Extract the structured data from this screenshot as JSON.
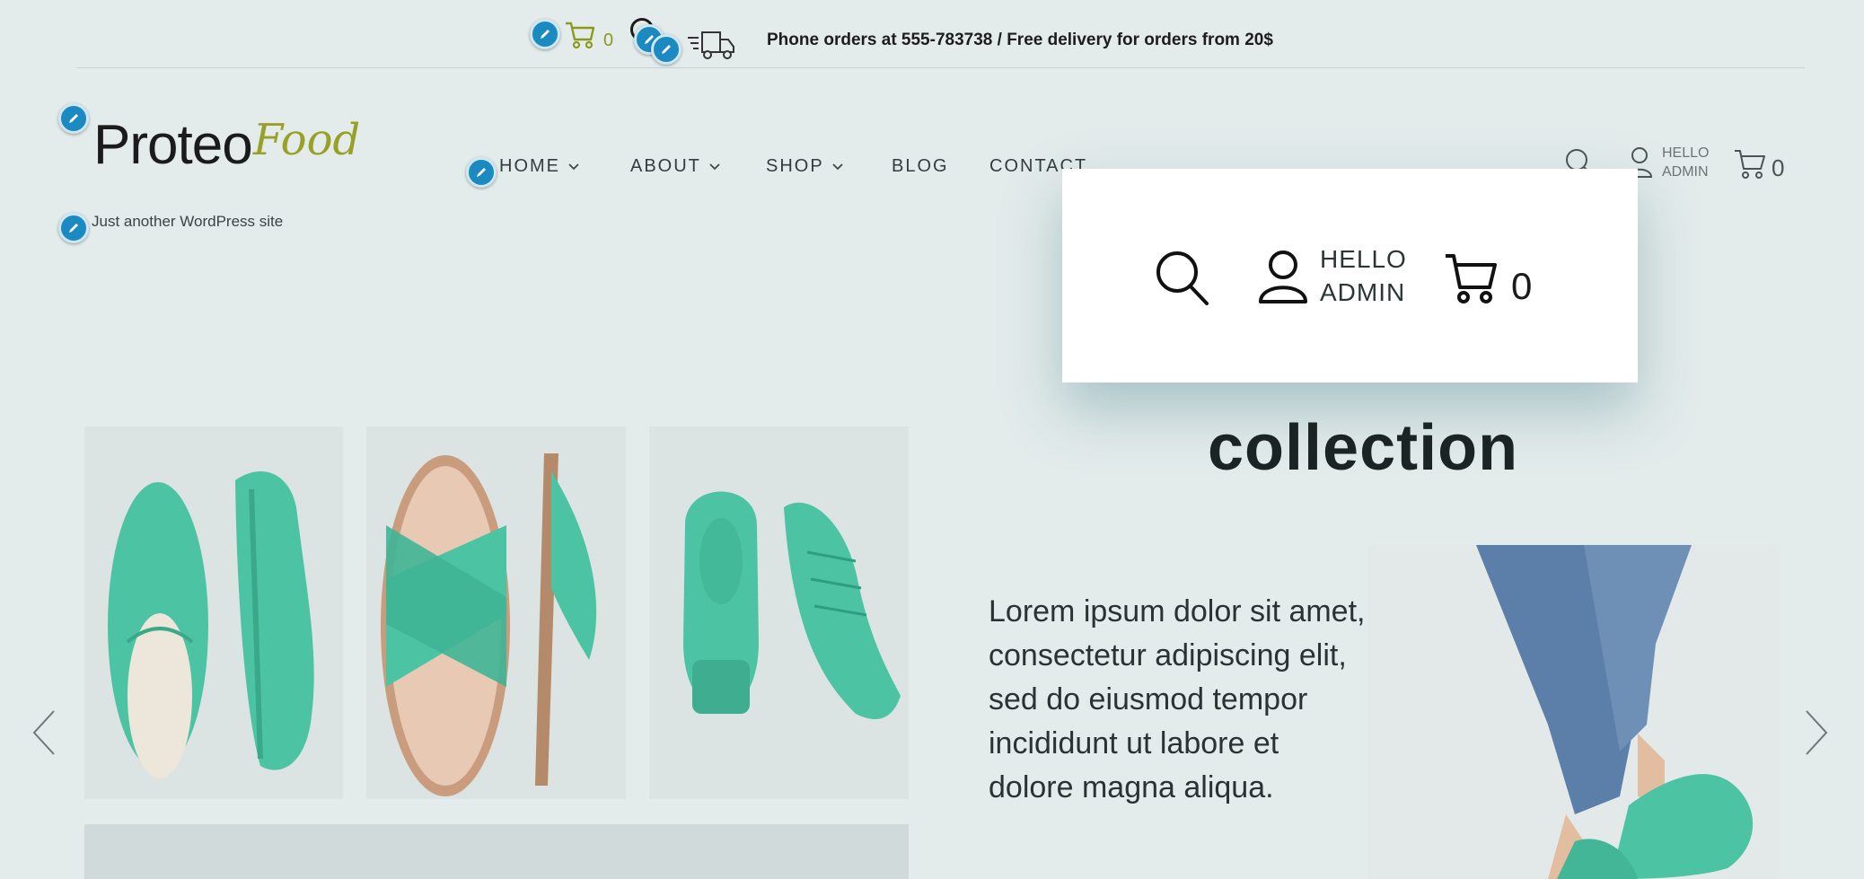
{
  "topbar": {
    "cart_count": "0",
    "notice": "Phone orders at 555-783738 / Free delivery for orders from 20$"
  },
  "site": {
    "logo_main": "Proteo",
    "logo_accent": "Food",
    "tagline": "Just another WordPress site"
  },
  "nav": {
    "items": [
      {
        "label": "HOME",
        "has_dropdown": true
      },
      {
        "label": "ABOUT",
        "has_dropdown": true
      },
      {
        "label": "SHOP",
        "has_dropdown": true
      },
      {
        "label": "BLOG",
        "has_dropdown": false
      },
      {
        "label": "CONTACT",
        "has_dropdown": false
      }
    ]
  },
  "header_tools": {
    "hello_line1": "HELLO",
    "hello_line2": "ADMIN",
    "cart_count": "0"
  },
  "popup": {
    "hello_line1": "HELLO",
    "hello_line2": "ADMIN",
    "cart_count": "0"
  },
  "hero": {
    "heading": "collection",
    "body": "Lorem ipsum dolor sit amet, consectetur adipiscing elit, sed do eiusmod tempor incididunt ut labore et dolore magna aliqua."
  },
  "product_images": [
    {
      "alt": "Green espadrilles"
    },
    {
      "alt": "Green cross-strap sandals"
    },
    {
      "alt": "Green knit sneakers"
    }
  ],
  "colors": {
    "background": "#e3ebeb",
    "accent_green": "#97a126",
    "shoe_teal": "#4cc3a3",
    "edit_badge": "#1b8ac0"
  },
  "icons": [
    "pencil-icon",
    "cart-icon",
    "truck-icon",
    "search-icon",
    "user-icon",
    "chevron-down-icon",
    "chevron-left-icon",
    "chevron-right-icon"
  ]
}
